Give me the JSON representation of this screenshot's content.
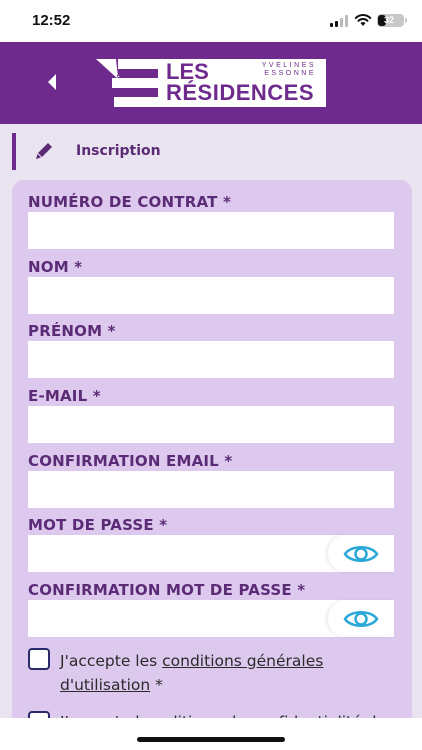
{
  "status": {
    "time": "12:52",
    "battery": "32",
    "battery_level": 0.32
  },
  "header": {
    "logo": {
      "subtitle_line1": "YVELINES",
      "subtitle_line2": "ESSONNE",
      "line1": "LES",
      "line2": "RÉSIDENCES"
    },
    "back_icon": "chevron-left-icon"
  },
  "section": {
    "title": "Inscription",
    "icon": "pencil-icon"
  },
  "form": {
    "fields": [
      {
        "label": "NUMÉRO DE CONTRAT *",
        "value": "",
        "placeholder": ""
      },
      {
        "label": "NOM *",
        "value": "",
        "placeholder": ""
      },
      {
        "label": "PRÉNOM *",
        "value": "",
        "placeholder": ""
      },
      {
        "label": "E-MAIL *",
        "value": "",
        "placeholder": ""
      },
      {
        "label": "CONFIRMATION EMAIL *",
        "value": "",
        "placeholder": ""
      },
      {
        "label": "MOT DE PASSE *",
        "value": "",
        "placeholder": ""
      },
      {
        "label": "CONFIRMATION MOT DE PASSE *",
        "value": "",
        "placeholder": ""
      }
    ],
    "cgu": {
      "prefix": "J'accepte les ",
      "link": "conditions générales d'utilisation",
      "suffix": " *",
      "checked": false
    },
    "privacy_partial": "J'accepte la politique de confidentialité de"
  },
  "colors": {
    "header": "#6f2a8d",
    "card": "#ddc9ee",
    "label": "#5b2b76",
    "eye": "#2aa8d8"
  }
}
